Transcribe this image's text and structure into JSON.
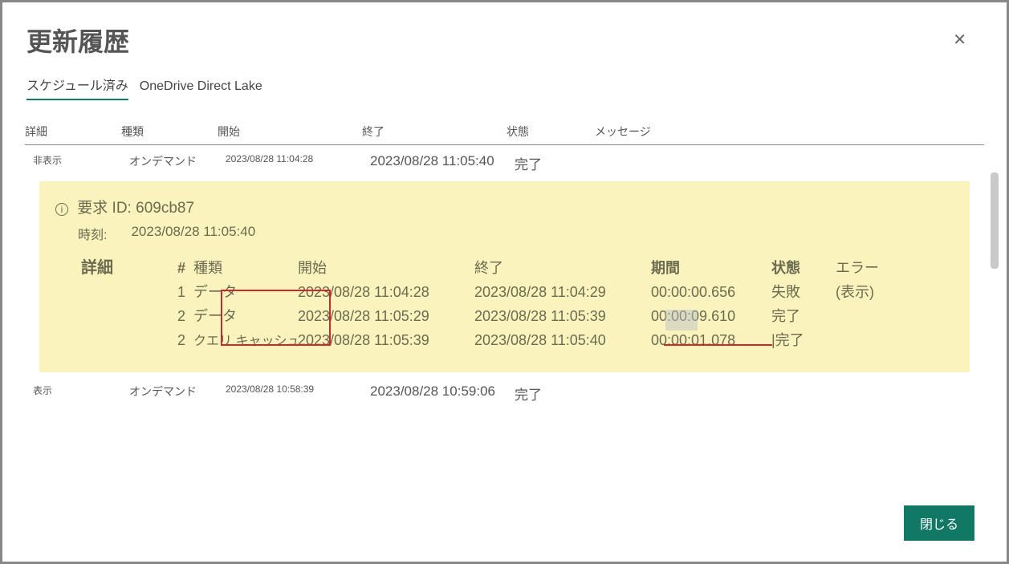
{
  "header": {
    "title": "更新履歴"
  },
  "tabs": {
    "active": "スケジュール済み",
    "other": "OneDrive Direct Lake"
  },
  "columns": {
    "detail": "詳細",
    "type": "種類",
    "start": "開始",
    "end": "終了",
    "state": "状態",
    "message": "メッセージ"
  },
  "rows": {
    "r1": {
      "detail": "非表示",
      "type": "オンデマンド",
      "start": "2023/08/28 11:04:28",
      "end": "2023/08/28  11:05:40",
      "state": "完了"
    },
    "r2": {
      "detail": "表示",
      "type": "オンデマンド",
      "start": "2023/08/28 10:58:39",
      "end": "2023/08/28  10:59:06",
      "state": "完了"
    }
  },
  "panel": {
    "req_label": "要求 ID:",
    "req_id": "609cb87",
    "time_label": "時刻:",
    "time_val": "2023/08/28 11:05:40",
    "detail_label": "詳細",
    "cols": {
      "num": "#",
      "type": "種類",
      "start": "開始",
      "end": "終了",
      "dur": "期間",
      "state": "状態",
      "err": "エラー"
    },
    "d1": {
      "n": "1",
      "type": "データ",
      "start": "2023/08/28  11:04:28",
      "end": "2023/08/28  11:04:29",
      "dur": "00:00:00.656",
      "state": "失敗",
      "err": "(表示)"
    },
    "d2": {
      "n": "2",
      "type": "データ",
      "start": "2023/08/28  11:05:29",
      "end": "2023/08/28  11:05:39",
      "dur": "00:00:09.610",
      "state": "完了"
    },
    "d3": {
      "n": "2",
      "type": "クエリ キャッシュ",
      "start": "2023/08/28  11:05:39",
      "end": "2023/08/28  11:05:40",
      "dur": "00:00:01.078",
      "state": "|完了"
    }
  },
  "footer": {
    "close": "閉じる"
  }
}
